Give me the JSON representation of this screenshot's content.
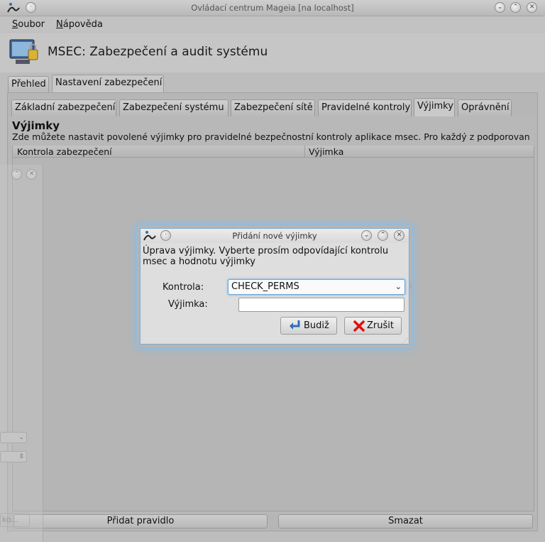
{
  "window": {
    "title": "Ovládací centrum Mageia  [na localhost]",
    "app_icon": "mageia-logo-icon",
    "controls": [
      "minimize-icon",
      "maximize-icon",
      "close-icon"
    ]
  },
  "menubar": [
    {
      "label": "Soubor",
      "mnemonic": "S"
    },
    {
      "label": "Nápověda",
      "mnemonic": "N"
    }
  ],
  "header": {
    "icon": "msec-security-icon",
    "title": "MSEC: Zabezpečení a audit systému"
  },
  "top_tabs": [
    {
      "label": "Přehled",
      "active": false
    },
    {
      "label": "Nastavení zabezpečení",
      "active": true
    }
  ],
  "sub_tabs": [
    {
      "label": "Základní zabezpečení",
      "active": false
    },
    {
      "label": "Zabezpečení systému",
      "active": false
    },
    {
      "label": "Zabezpečení sítě",
      "active": false
    },
    {
      "label": "Pravidelné kontroly",
      "active": false
    },
    {
      "label": "Výjimky",
      "active": true
    },
    {
      "label": "Oprávnění",
      "active": false
    }
  ],
  "section": {
    "title": "Výjimky",
    "description": "Zde můžete nastavit povolené výjimky pro pravidelné bezpečnostní kontroly aplikace msec. Pro každý z podporovan",
    "columns": [
      "Kontrola zabezpečení",
      "Výjimka"
    ]
  },
  "buttons": {
    "add_rule": "Přidat pravidlo",
    "delete": "Smazat"
  },
  "dialog": {
    "title": "Přidání nové výjimky",
    "message": "Úprava výjimky. Vyberte prosím odpovídající kontrolu msec a hodnotu výjimky",
    "control_label": "Kontrola:",
    "control_value": "CHECK_PERMS",
    "exception_label": "Výjimka:",
    "exception_value": "",
    "ok_label": "Budiž",
    "cancel_label": "Zrušit",
    "ok_icon": "arrow-left-icon",
    "cancel_icon": "red-x-icon"
  },
  "ghost_window": {
    "partial_text": "ko..."
  }
}
